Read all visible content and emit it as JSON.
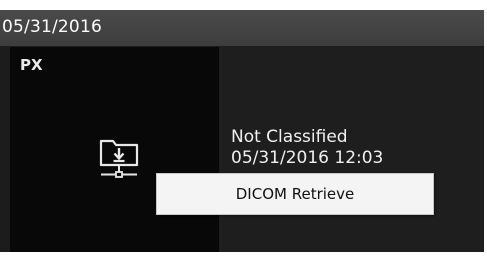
{
  "header": {
    "date": "05/31/2016"
  },
  "tile": {
    "label": "PX",
    "icon": "folder-download-network-icon"
  },
  "info": {
    "status": "Not Classified",
    "datetime": "05/31/2016 12:03"
  },
  "context_menu": {
    "items": [
      {
        "label": "DICOM Retrieve"
      }
    ]
  },
  "colors": {
    "header_bg": "#444444",
    "panel_bg": "#1c1c1c",
    "tile_bg": "#080808",
    "menu_bg": "#f4f4f4",
    "text_light": "#f0f0f0"
  }
}
